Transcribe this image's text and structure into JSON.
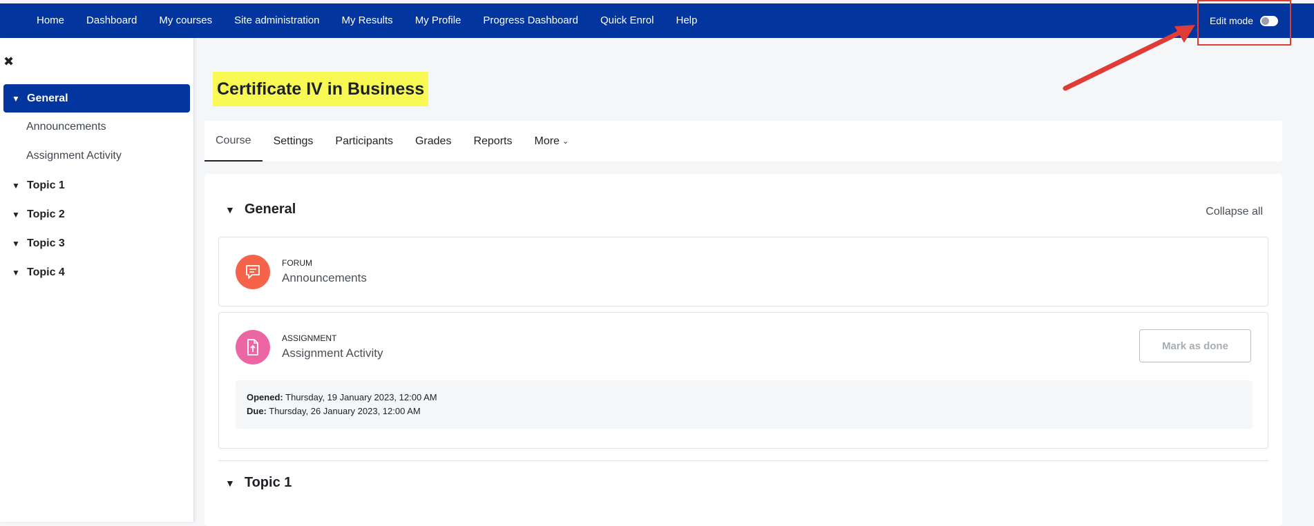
{
  "nav": {
    "items": [
      "Home",
      "Dashboard",
      "My courses",
      "Site administration",
      "My Results",
      "My Profile",
      "Progress Dashboard",
      "Quick Enrol",
      "Help"
    ],
    "edit_mode_label": "Edit mode"
  },
  "drawer": {
    "close_glyph": "✖",
    "sections": [
      {
        "label": "General",
        "active": true
      },
      {
        "label": "Topic 1"
      },
      {
        "label": "Topic 2"
      },
      {
        "label": "Topic 3"
      },
      {
        "label": "Topic 4"
      }
    ],
    "general_items": [
      "Announcements",
      "Assignment Activity"
    ]
  },
  "course": {
    "title": "Certificate IV in Business"
  },
  "tabs": [
    "Course",
    "Settings",
    "Participants",
    "Grades",
    "Reports",
    "More"
  ],
  "main": {
    "general_heading": "General",
    "collapse_all": "Collapse all",
    "topic1_heading": "Topic 1",
    "forum": {
      "type": "FORUM",
      "name": "Announcements",
      "icon": "forum-icon",
      "color": "#f5634a"
    },
    "assignment": {
      "type": "ASSIGNMENT",
      "name": "Assignment Activity",
      "icon": "assignment-icon",
      "color": "#eb66a2",
      "mark_done": "Mark as done",
      "opened_label": "Opened:",
      "opened_value": "Thursday, 19 January 2023, 12:00 AM",
      "due_label": "Due:",
      "due_value": "Thursday, 26 January 2023, 12:00 AM"
    }
  },
  "colors": {
    "navbar": "#03359e",
    "highlight": "#f8f953",
    "annotation": "#e03c37"
  }
}
